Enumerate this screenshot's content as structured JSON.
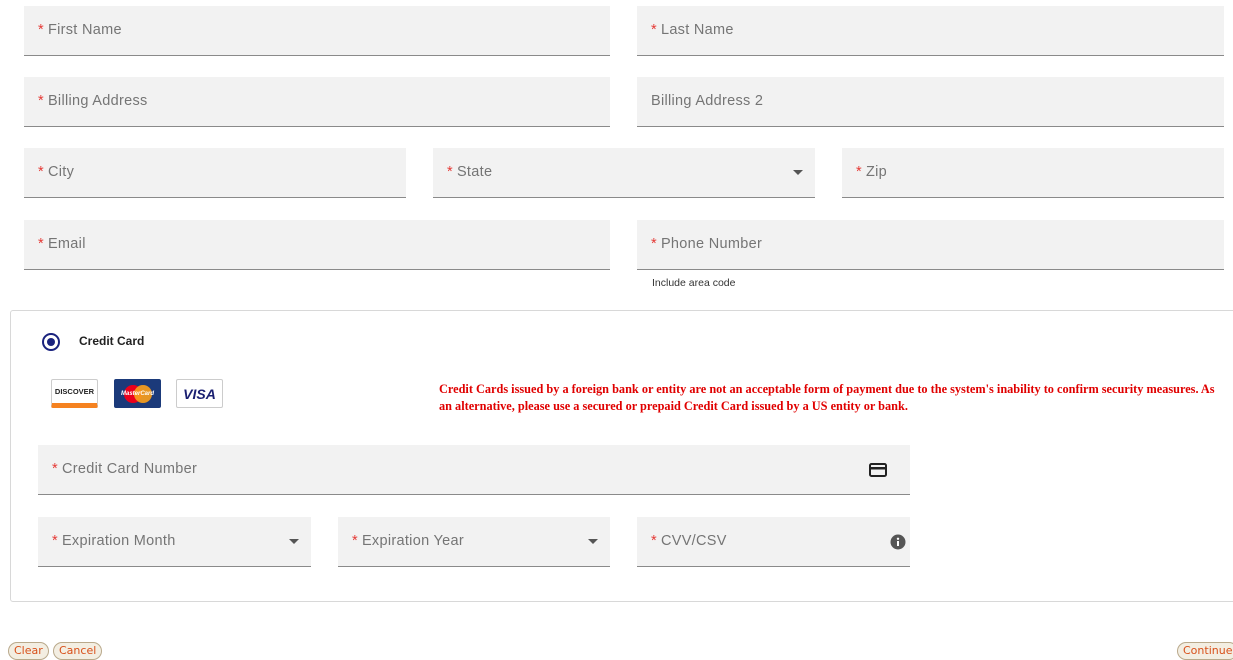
{
  "form": {
    "required_marker": "*",
    "first_name": {
      "label": "First Name",
      "value": ""
    },
    "last_name": {
      "label": "Last Name",
      "value": ""
    },
    "billing_address": {
      "label": "Billing Address",
      "value": ""
    },
    "billing_address_2": {
      "label": "Billing Address 2",
      "value": ""
    },
    "city": {
      "label": "City",
      "value": ""
    },
    "state": {
      "label": "State",
      "selected": ""
    },
    "zip": {
      "label": "Zip",
      "value": ""
    },
    "email": {
      "label": "Email",
      "value": ""
    },
    "phone": {
      "label": "Phone Number",
      "value": "",
      "hint": "Include area code"
    }
  },
  "payment": {
    "method_label": "Credit Card",
    "method_selected": true,
    "card_brands": [
      "DISCOVER",
      "MasterCard",
      "VISA"
    ],
    "warning": "Credit Cards issued by a foreign bank or entity are not an acceptable form of payment due to the system's inability to confirm security measures. As an alternative, please use a secured or prepaid Credit Card issued by a US entity or bank.",
    "card_number": {
      "label": "Credit Card Number",
      "value": "",
      "icon": "credit-card-icon"
    },
    "exp_month": {
      "label": "Expiration Month",
      "selected": ""
    },
    "exp_year": {
      "label": "Expiration Year",
      "selected": ""
    },
    "cvv": {
      "label": "CVV/CSV",
      "value": "",
      "icon": "info-icon"
    }
  },
  "buttons": {
    "clear": "Clear",
    "cancel": "Cancel",
    "continue": "Continue"
  },
  "colors": {
    "required": "#e53935",
    "warning": "#e00000",
    "radio": "#1a237e",
    "button_text": "#d8501a"
  }
}
